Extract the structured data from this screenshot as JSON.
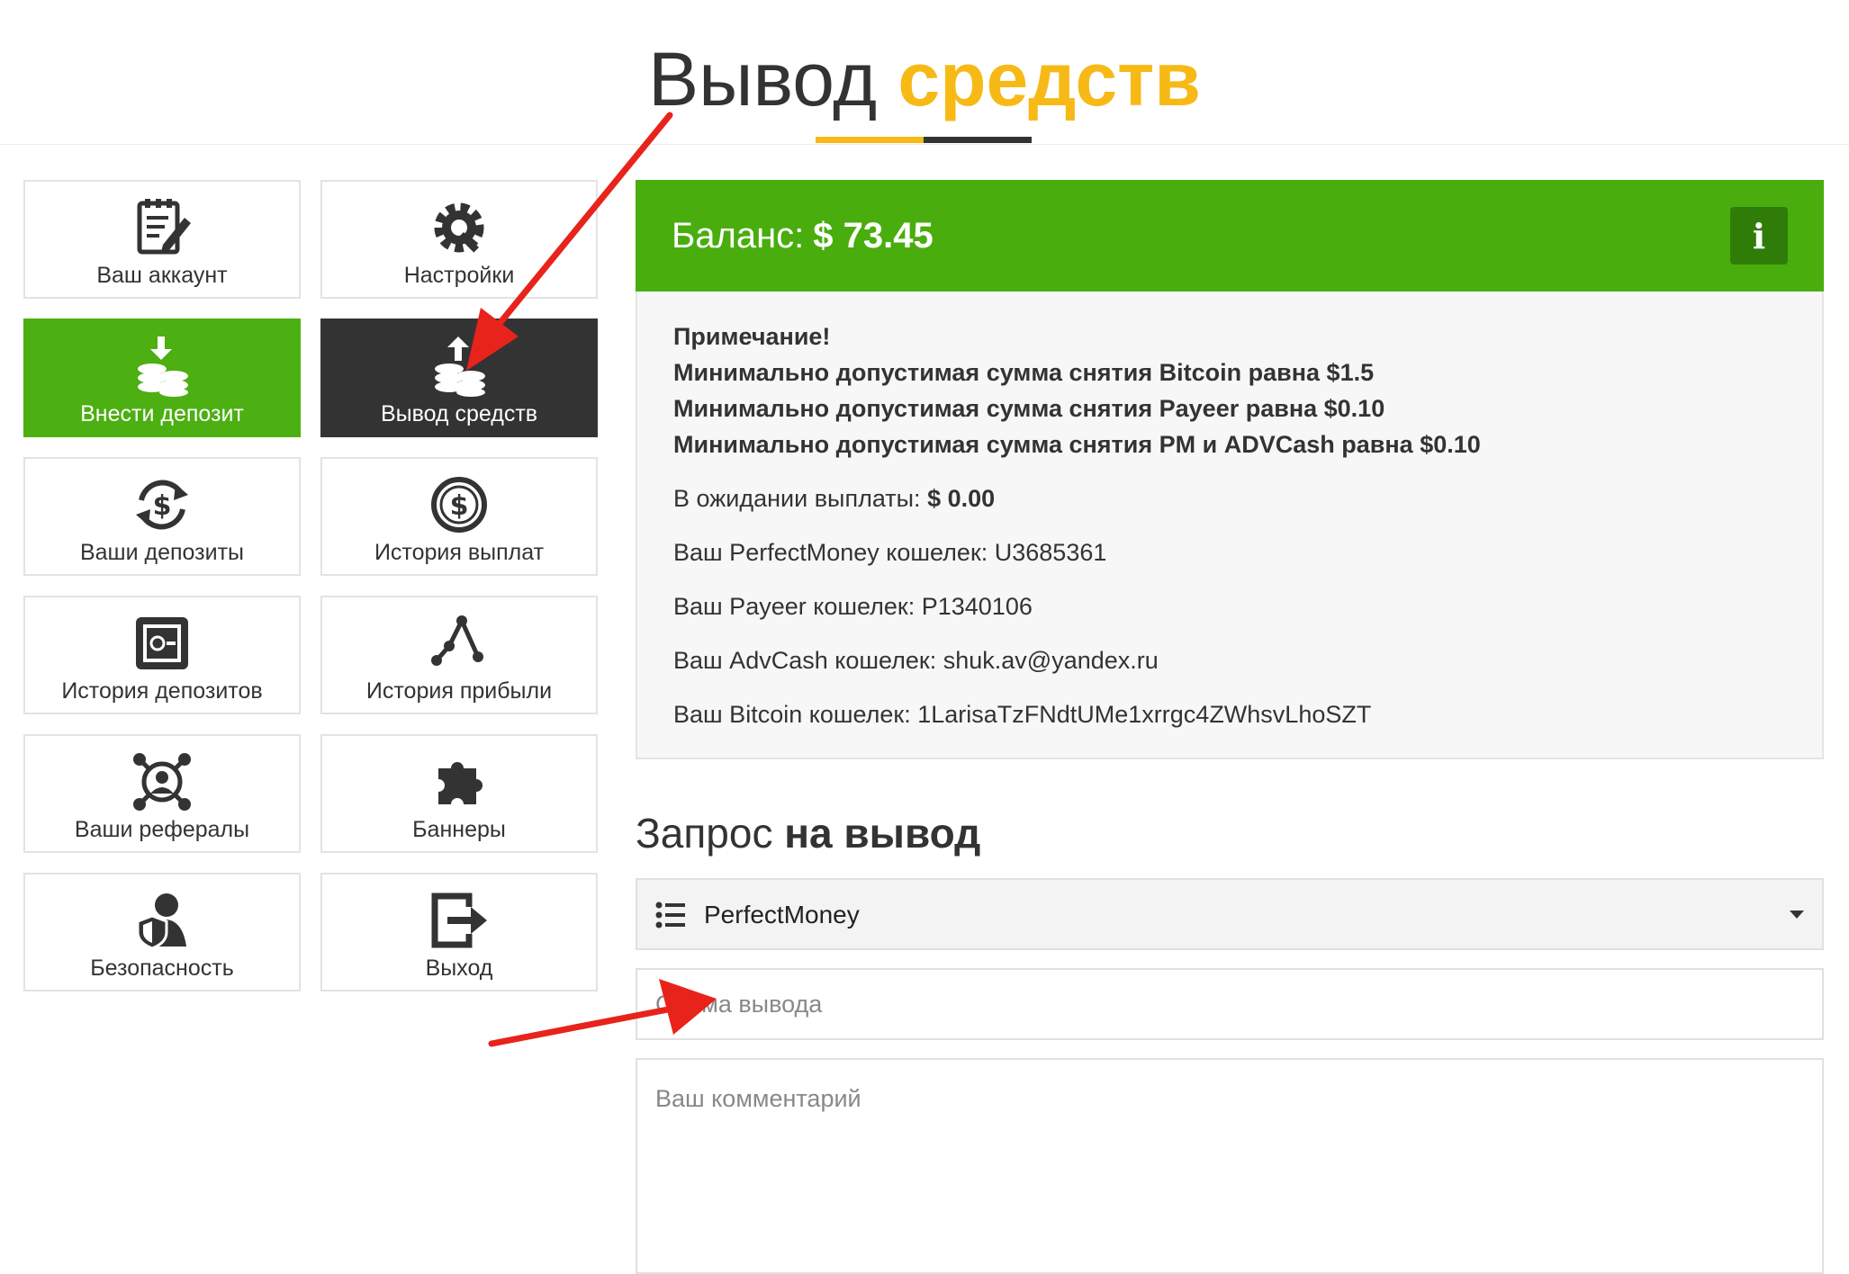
{
  "page": {
    "title_part1": "Вывод",
    "title_part2": "средств"
  },
  "menu": {
    "items": [
      {
        "label": "Ваш аккаунт",
        "icon": "account-edit-icon"
      },
      {
        "label": "Настройки",
        "icon": "settings-gear-icon"
      },
      {
        "label": "Внести депозит",
        "icon": "deposit-coins-icon",
        "state": "highlighted-green"
      },
      {
        "label": "Вывод средств",
        "icon": "withdraw-coins-icon",
        "state": "active"
      },
      {
        "label": "Ваши депозиты",
        "icon": "dollar-refresh-icon"
      },
      {
        "label": "История выплат",
        "icon": "dollar-circle-icon"
      },
      {
        "label": "История депозитов",
        "icon": "safe-icon"
      },
      {
        "label": "История прибыли",
        "icon": "profit-graph-icon"
      },
      {
        "label": "Ваши рефералы",
        "icon": "referrals-network-icon"
      },
      {
        "label": "Баннеры",
        "icon": "puzzle-icon"
      },
      {
        "label": "Безопасность",
        "icon": "security-user-shield-icon"
      },
      {
        "label": "Выход",
        "icon": "logout-icon"
      }
    ]
  },
  "balance": {
    "label": "Баланс:",
    "amount": "$ 73.45",
    "info_icon": "info-icon",
    "info_glyph": "i"
  },
  "notes": {
    "heading": "Примечание!",
    "lines": [
      "Минимально допустимая сумма снятия Bitcoin равна $1.5",
      "Минимально допустимая сумма снятия Payeer равна $0.10",
      "Минимально допустимая сумма снятия PM и ADVCash равна $0.10"
    ],
    "pending_label": "В ожидании выплаты:",
    "pending_value": "$ 0.00",
    "wallets": [
      "Ваш PerfectMoney кошелек: U3685361",
      "Ваш Payeer кошелек: P1340106",
      "Ваш AdvCash кошелек: shuk.av@yandex.ru",
      "Ваш Bitcoin кошелек: 1LarisaTzFNdtUMe1xrrgc4ZWhsvLhoSZT"
    ]
  },
  "request": {
    "title_light": "Запрос",
    "title_bold": "на вывод",
    "payment_system": "PerfectMoney",
    "amount_placeholder": "Сумма вывода",
    "comment_placeholder": "Ваш комментарий"
  },
  "colors": {
    "accent_yellow": "#f7b916",
    "dark": "#333333",
    "green": "#4caf12",
    "balance_green": "#49ad0d",
    "annotation_red": "#e8231b"
  }
}
